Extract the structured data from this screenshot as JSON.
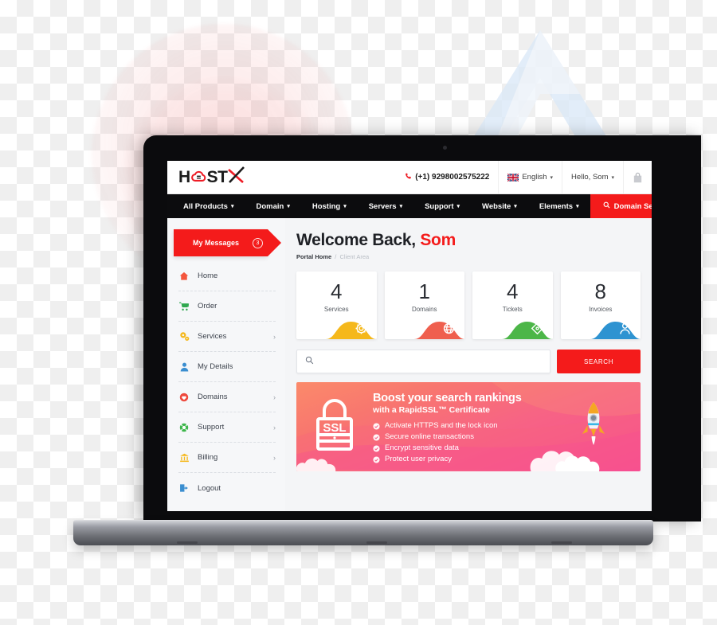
{
  "brand": {
    "logo_text_left": "H",
    "logo_text_mid": "ST",
    "logo_icon": "cloud-icon",
    "logo_x": "X",
    "accent_color": "#f41b1b",
    "dark_color": "#0c0c0e"
  },
  "topbar": {
    "phone_icon": "phone-icon",
    "phone": "(+1) 9298002575222",
    "language_flag": "uk-flag-icon",
    "language": "English",
    "language_caret": "▾",
    "account": "Hello, Som",
    "account_caret": "▾",
    "cart_icon": "shopping-bag-icon"
  },
  "nav": {
    "items": [
      {
        "label": "All Products",
        "caret": "▾"
      },
      {
        "label": "Domain",
        "caret": "▾"
      },
      {
        "label": "Hosting",
        "caret": "▾"
      },
      {
        "label": "Servers",
        "caret": "▾"
      },
      {
        "label": "Support",
        "caret": "▾"
      },
      {
        "label": "Website",
        "caret": "▾"
      },
      {
        "label": "Elements",
        "caret": "▾"
      }
    ],
    "domain_search": {
      "label": "Domain Search",
      "icon": "search-icon",
      "bg": "#f41b1b"
    }
  },
  "sidebar": {
    "messages": {
      "label": "My Messages",
      "count": "3",
      "bg": "#f41b1b"
    },
    "items": [
      {
        "label": "Home",
        "icon": "house-icon",
        "color": "#f4553d",
        "chevron": ""
      },
      {
        "label": "Order",
        "icon": "cart-icon",
        "color": "#2fa84f",
        "chevron": ""
      },
      {
        "label": "Services",
        "icon": "gears-icon",
        "color": "#f5b81b",
        "chevron": "›"
      },
      {
        "label": "My Details",
        "icon": "user-icon",
        "color": "#3b8ed0",
        "chevron": ""
      },
      {
        "label": "Domains",
        "icon": "globe-heart-icon",
        "color": "#ee4a3e",
        "chevron": "›"
      },
      {
        "label": "Support",
        "icon": "lifebuoy-icon",
        "color": "#3cb54a",
        "chevron": "›"
      },
      {
        "label": "Billing",
        "icon": "bank-icon",
        "color": "#f5b81b",
        "chevron": "›"
      },
      {
        "label": "Logout",
        "icon": "logout-icon",
        "color": "#3b8ed0",
        "chevron": ""
      }
    ]
  },
  "main": {
    "welcome_prefix": "Welcome Back, ",
    "welcome_name": "Som",
    "breadcrumb": {
      "home": "Portal Home",
      "separator": "/",
      "current": "Client Area"
    },
    "cards": [
      {
        "value": "4",
        "caption": "Services",
        "color": "#f5b81b",
        "icon": "gear-icon"
      },
      {
        "value": "1",
        "caption": "Domains",
        "color": "#ef5f4e",
        "icon": "globe-icon"
      },
      {
        "value": "4",
        "caption": "Tickets",
        "color": "#4cb648",
        "icon": "tag-icon"
      },
      {
        "value": "8",
        "caption": "Invoices",
        "color": "#2e93d1",
        "icon": "user-icon"
      }
    ],
    "search": {
      "icon": "search-icon",
      "value": "",
      "placeholder": "",
      "button_label": "SEARCH",
      "button_color": "#f41b1b"
    },
    "promo": {
      "lock_icon": "ssl-padlock-icon",
      "lock_text": "SSL",
      "headline": "Boost your search rankings",
      "subhead": "with a RapidSSL™ Certificate",
      "bullets": [
        "Activate HTTPS and the lock icon",
        "Secure online transactions",
        "Encrypt sensitive data",
        "Protect user privacy"
      ],
      "bullet_icon": "check-circle-icon",
      "illustration": "rocket-icon",
      "gradient_from": "#fb8a6a",
      "gradient_to": "#f74d93"
    }
  }
}
